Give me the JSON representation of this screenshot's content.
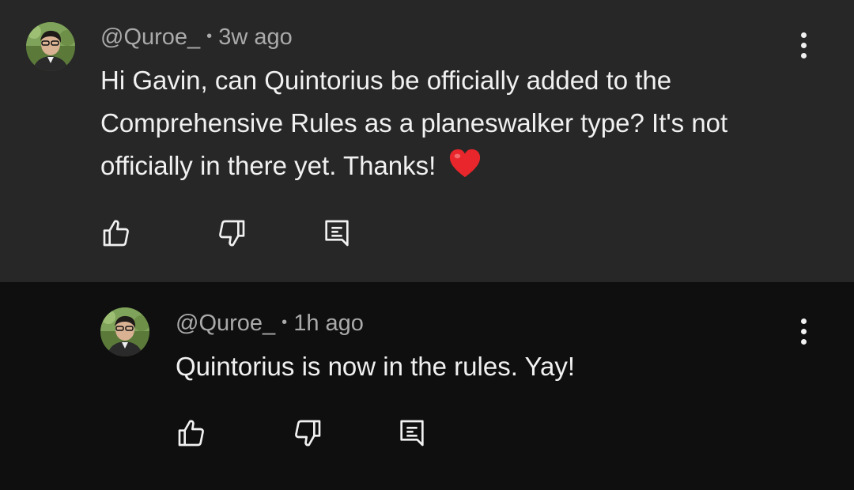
{
  "comments": [
    {
      "author": "@Quroe_",
      "separator": "•",
      "time": "3w ago",
      "text": "Hi Gavin, can Quintorius be officially added to the Comprehensive Rules as a planeswalker type? It's not officially in there yet. Thanks!",
      "emoji": "heart-emoji"
    },
    {
      "author": "@Quroe_",
      "separator": "•",
      "time": "1h ago",
      "text": "Quintorius is now in the rules. Yay!"
    }
  ],
  "icons": {
    "like": "thumbs-up-icon",
    "dislike": "thumbs-down-icon",
    "reply": "reply-comment-icon",
    "more": "more-vert-icon"
  },
  "colors": {
    "parent_bg": "#272727",
    "reply_bg": "#0f0f0f",
    "text": "#f1f1f1",
    "meta": "#aaaaaa",
    "heart": "#e8262b"
  }
}
